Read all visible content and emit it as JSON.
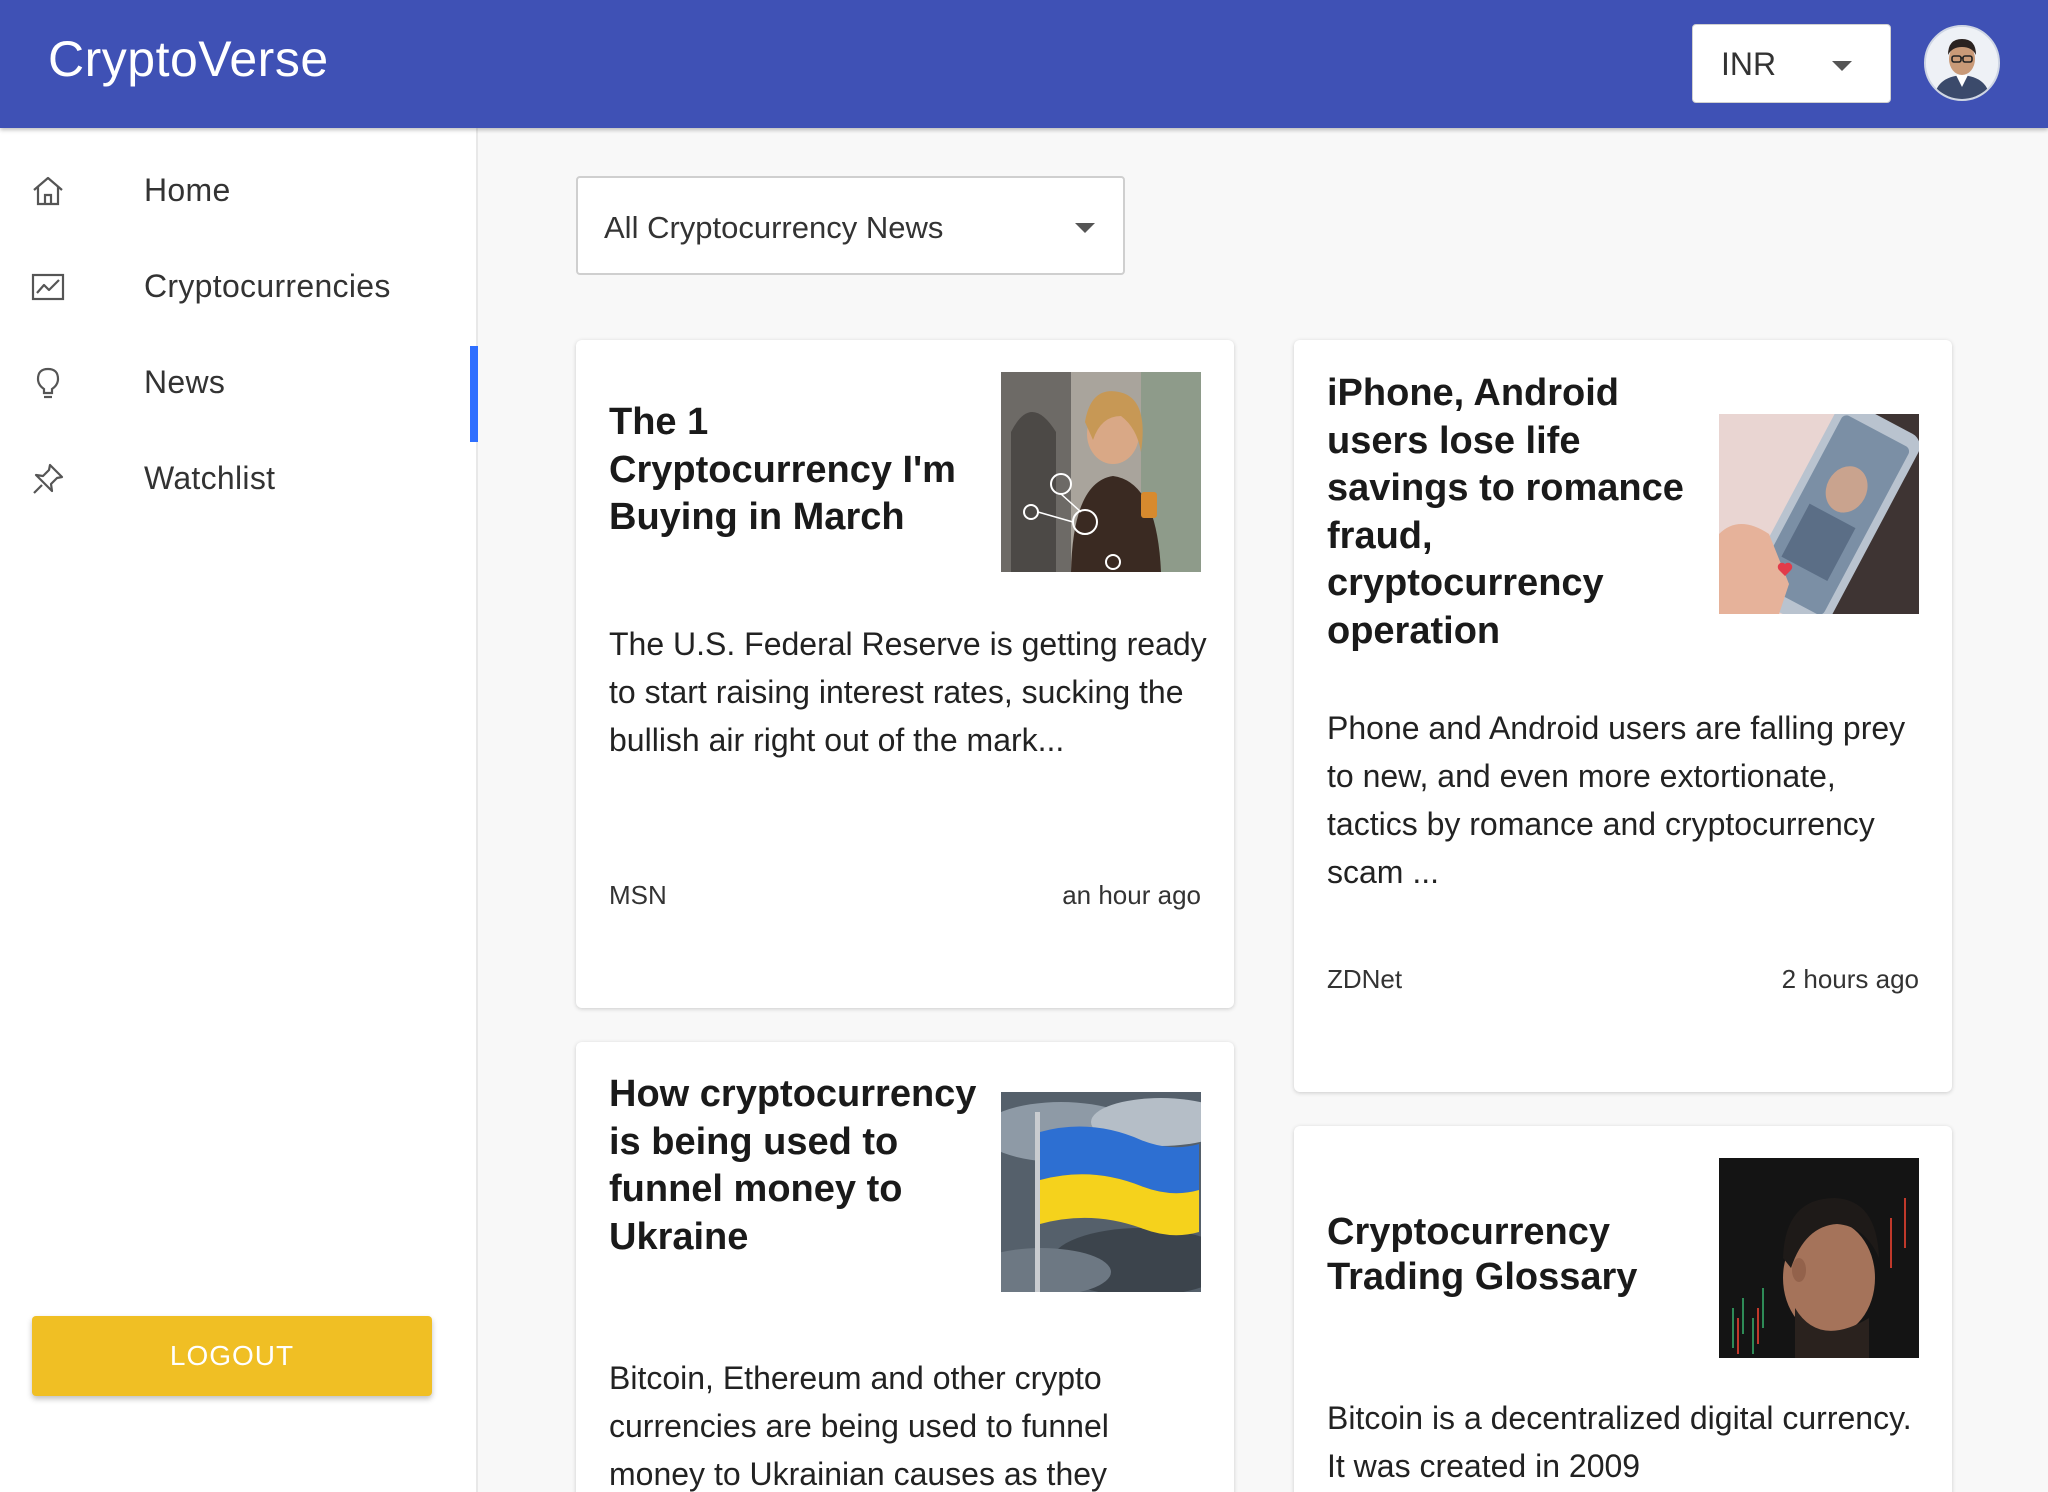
{
  "app": {
    "brand": "CryptoVerse"
  },
  "header": {
    "currency": {
      "selected": "INR"
    },
    "avatar": {
      "icon": "user-avatar"
    }
  },
  "sidebar": {
    "items": [
      {
        "label": "Home",
        "icon": "home-icon",
        "active": false
      },
      {
        "label": "Cryptocurrencies",
        "icon": "chart-icon",
        "active": false
      },
      {
        "label": "News",
        "icon": "bulb-icon",
        "active": true
      },
      {
        "label": "Watchlist",
        "icon": "pin-icon",
        "active": false
      }
    ],
    "logout_label": "LOGOUT"
  },
  "filter": {
    "selected": "All Cryptocurrency News"
  },
  "news": [
    {
      "title": "The 1 Cryptocurrency I'm Buying in March",
      "description": "The U.S. Federal Reserve is getting ready to start raising interest rates, sucking the bullish air right out of the mark...",
      "source": "MSN",
      "time": "an hour ago"
    },
    {
      "title": "iPhone, Android users lose life savings to romance fraud, cryptocurrency operation",
      "description": "Phone and Android users are falling prey to new, and even more extortionate, tactics by romance and cryptocurrency scam ...",
      "source": "ZDNet",
      "time": "2 hours ago"
    },
    {
      "title": "How cryptocurrency is being used to funnel money to Ukraine",
      "description": "Bitcoin, Ethereum and other crypto currencies are being used to funnel money to Ukrainian causes as they",
      "source": "",
      "time": ""
    },
    {
      "title": "Cryptocurrency Trading Glossary",
      "description": "Bitcoin is a decentralized digital currency. It was created in 2009",
      "source": "",
      "time": ""
    }
  ],
  "colors": {
    "appbar": "#3f51b5",
    "active_indicator": "#2f6fff",
    "logout": "#f0bf24",
    "background": "#f8f8f8"
  }
}
